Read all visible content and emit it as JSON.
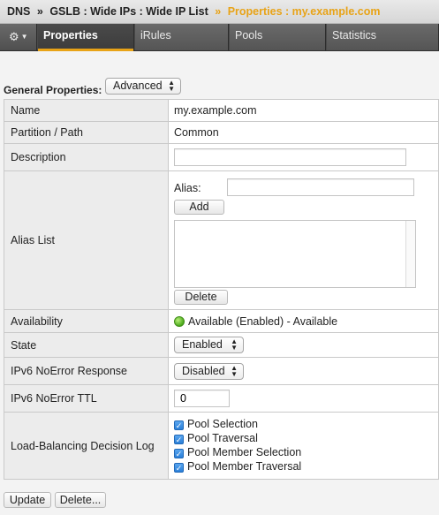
{
  "breadcrumb": {
    "items": [
      "DNS",
      "GSLB : Wide IPs : Wide IP List"
    ],
    "separator": "»",
    "current": "Properties : my.example.com"
  },
  "tabs": {
    "gear_icon": "gear-icon",
    "items": [
      {
        "label": "Properties",
        "active": true
      },
      {
        "label": "iRules",
        "active": false
      },
      {
        "label": "Pools",
        "active": false
      },
      {
        "label": "Statistics",
        "active": false
      }
    ]
  },
  "general": {
    "label": "General Properties:",
    "mode": "Advanced"
  },
  "props": {
    "name": {
      "label": "Name",
      "value": "my.example.com"
    },
    "partition": {
      "label": "Partition / Path",
      "value": "Common"
    },
    "description": {
      "label": "Description",
      "value": ""
    },
    "alias": {
      "label": "Alias List",
      "alias_label": "Alias:",
      "alias_value": "",
      "add": "Add",
      "delete": "Delete"
    },
    "availability": {
      "label": "Availability",
      "value": "Available (Enabled) - Available",
      "status_color": "#4caa1c"
    },
    "state": {
      "label": "State",
      "value": "Enabled"
    },
    "ipv6_noerror_response": {
      "label": "IPv6 NoError Response",
      "value": "Disabled"
    },
    "ipv6_noerror_ttl": {
      "label": "IPv6 NoError TTL",
      "value": "0"
    },
    "lb_log": {
      "label": "Load-Balancing Decision Log",
      "options": [
        {
          "label": "Pool Selection",
          "checked": true
        },
        {
          "label": "Pool Traversal",
          "checked": true
        },
        {
          "label": "Pool Member Selection",
          "checked": true
        },
        {
          "label": "Pool Member Traversal",
          "checked": true
        }
      ]
    }
  },
  "actions": {
    "update": "Update",
    "delete": "Delete..."
  },
  "colors": {
    "accent": "#e8a317",
    "tabbar": "#4a4a4a",
    "checkbox": "#2a7fd8"
  }
}
